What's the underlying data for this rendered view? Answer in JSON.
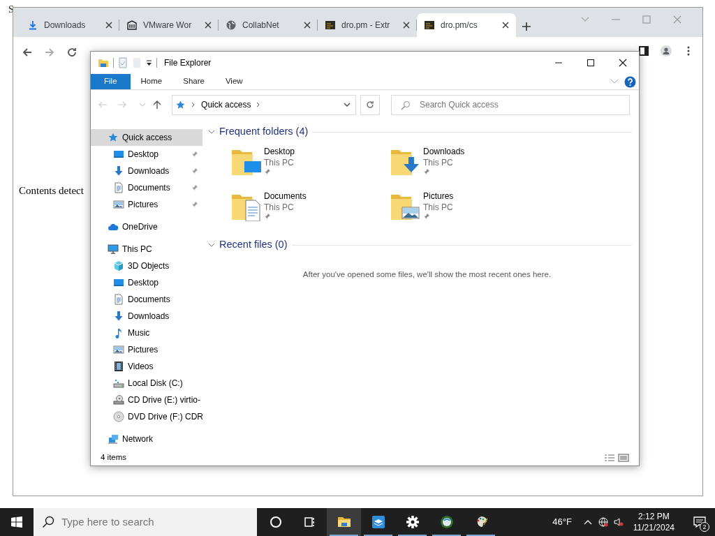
{
  "page_edge_text": "S",
  "browser": {
    "tabs": [
      {
        "title": "Downloads",
        "kind": "download",
        "selected": false
      },
      {
        "title": "VMware Wor",
        "kind": "building",
        "selected": false
      },
      {
        "title": "CollabNet",
        "kind": "globe",
        "selected": false
      },
      {
        "title": "dro.pm - Extr",
        "kind": "site",
        "selected": false
      },
      {
        "title": "dro.pm/cs",
        "kind": "site",
        "selected": true
      }
    ],
    "content_text": "Contents detect"
  },
  "explorer": {
    "title": "File Explorer",
    "ribbon_tabs": [
      {
        "label": "File",
        "selected": true
      },
      {
        "label": "Home",
        "selected": false
      },
      {
        "label": "Share",
        "selected": false
      },
      {
        "label": "View",
        "selected": false
      }
    ],
    "breadcrumb": "Quick access",
    "search": {
      "placeholder": "Search Quick access"
    },
    "nav_pane": [
      {
        "label": "Quick access",
        "kind": "star",
        "selected": true,
        "children": [
          {
            "label": "Desktop",
            "kind": "desktop",
            "pinned": true,
            "selected": false
          },
          {
            "label": "Downloads",
            "kind": "arrow",
            "pinned": true,
            "selected": false
          },
          {
            "label": "Documents",
            "kind": "document",
            "pinned": true,
            "selected": false
          },
          {
            "label": "Pictures",
            "kind": "picture",
            "pinned": true,
            "selected": false
          }
        ]
      },
      {
        "label": "OneDrive",
        "kind": "cloud",
        "selected": false
      },
      {
        "label": "This PC",
        "kind": "computer",
        "selected": false,
        "children": [
          {
            "label": "3D Objects",
            "kind": "cube",
            "pinned": false,
            "selected": false
          },
          {
            "label": "Desktop",
            "kind": "desktop",
            "pinned": false,
            "selected": false
          },
          {
            "label": "Documents",
            "kind": "document",
            "pinned": false,
            "selected": false
          },
          {
            "label": "Downloads",
            "kind": "arrow",
            "pinned": false,
            "selected": false
          },
          {
            "label": "Music",
            "kind": "music",
            "pinned": false,
            "selected": false
          },
          {
            "label": "Pictures",
            "kind": "picture",
            "pinned": false,
            "selected": false
          },
          {
            "label": "Videos",
            "kind": "video",
            "pinned": false,
            "selected": false
          },
          {
            "label": "Local Disk (C:)",
            "kind": "disk",
            "pinned": false,
            "selected": false
          },
          {
            "label": "CD Drive (E:) virtio-",
            "kind": "cd",
            "pinned": false,
            "selected": false
          },
          {
            "label": "DVD Drive (F:) CDR",
            "kind": "dvd",
            "pinned": false,
            "selected": false
          }
        ]
      },
      {
        "label": "Network",
        "kind": "network",
        "selected": false
      }
    ],
    "sections": [
      {
        "title": "Frequent folders (4)",
        "items": [
          {
            "name": "Desktop",
            "location": "This PC",
            "kind": "desktop",
            "pinned": true
          },
          {
            "name": "Downloads",
            "location": "This PC",
            "kind": "arrow",
            "pinned": true
          },
          {
            "name": "Documents",
            "location": "This PC",
            "kind": "document",
            "pinned": true
          },
          {
            "name": "Pictures",
            "location": "This PC",
            "kind": "picture",
            "pinned": true
          }
        ]
      },
      {
        "title": "Recent files (0)",
        "empty_message": "After you've opened some files, we'll show the most recent ones here."
      }
    ],
    "status_bar": "4 items"
  },
  "taskbar": {
    "search_placeholder": "Type here to search",
    "apps": [
      {
        "kind": "cortana",
        "active": false,
        "running": false
      },
      {
        "kind": "taskview",
        "active": false,
        "running": false
      },
      {
        "kind": "folder",
        "active": true,
        "running": true
      },
      {
        "kind": "box",
        "active": false,
        "running": true
      },
      {
        "kind": "gear",
        "active": false,
        "running": true
      },
      {
        "kind": "globeapp",
        "active": false,
        "running": true
      },
      {
        "kind": "palette",
        "active": false,
        "running": true
      }
    ],
    "temperature": "46°F",
    "time": "2:12 PM",
    "date": "11/21/2024",
    "notification_count": "2"
  }
}
